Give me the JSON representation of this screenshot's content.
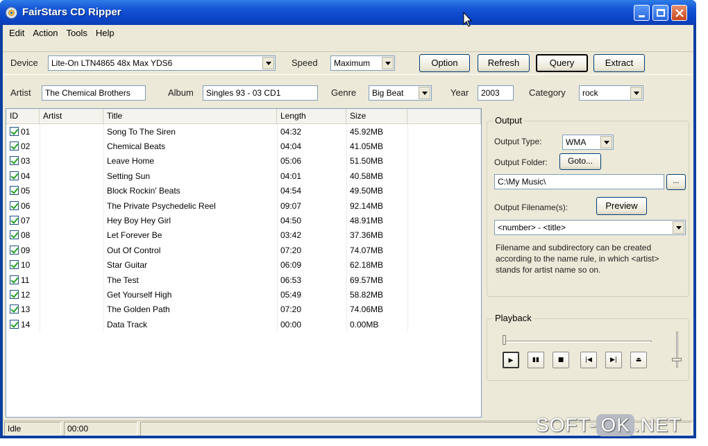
{
  "window": {
    "title": "FairStars CD Ripper",
    "icon": "cd-disc-icon"
  },
  "menu": [
    "Edit",
    "Action",
    "Tools",
    "Help"
  ],
  "toolbar": {
    "device_label": "Device",
    "device_value": "Lite-On LTN4865 48x Max YDS6",
    "speed_label": "Speed",
    "speed_value": "Maximum",
    "option_label": "Option",
    "refresh_label": "Refresh",
    "query_label": "Query",
    "extract_label": "Extract"
  },
  "meta": {
    "artist_label": "Artist",
    "artist_value": "The Chemical Brothers",
    "album_label": "Album",
    "album_value": "Singles 93 - 03 CD1",
    "genre_label": "Genre",
    "genre_value": "Big Beat",
    "year_label": "Year",
    "year_value": "2003",
    "category_label": "Category",
    "category_value": "rock"
  },
  "tracklist": {
    "columns": [
      "ID",
      "Artist",
      "Title",
      "Length",
      "Size"
    ],
    "rows": [
      {
        "id": "01",
        "artist": "",
        "title": "Song To The Siren",
        "length": "04:32",
        "size": "45.92MB"
      },
      {
        "id": "02",
        "artist": "",
        "title": "Chemical Beats",
        "length": "04:04",
        "size": "41.05MB"
      },
      {
        "id": "03",
        "artist": "",
        "title": "Leave Home",
        "length": "05:06",
        "size": "51.50MB"
      },
      {
        "id": "04",
        "artist": "",
        "title": "Setting Sun",
        "length": "04:01",
        "size": "40.58MB"
      },
      {
        "id": "05",
        "artist": "",
        "title": "Block Rockin' Beats",
        "length": "04:54",
        "size": "49.50MB"
      },
      {
        "id": "06",
        "artist": "",
        "title": "The Private Psychedelic Reel",
        "length": "09:07",
        "size": "92.14MB"
      },
      {
        "id": "07",
        "artist": "",
        "title": "Hey Boy Hey Girl",
        "length": "04:50",
        "size": "48.91MB"
      },
      {
        "id": "08",
        "artist": "",
        "title": "Let Forever Be",
        "length": "03:42",
        "size": "37.36MB"
      },
      {
        "id": "09",
        "artist": "",
        "title": "Out Of Control",
        "length": "07:20",
        "size": "74.07MB"
      },
      {
        "id": "10",
        "artist": "",
        "title": "Star Guitar",
        "length": "06:09",
        "size": "62.18MB"
      },
      {
        "id": "11",
        "artist": "",
        "title": "The Test",
        "length": "06:53",
        "size": "69.57MB"
      },
      {
        "id": "12",
        "artist": "",
        "title": "Get Yourself High",
        "length": "05:49",
        "size": "58.82MB"
      },
      {
        "id": "13",
        "artist": "",
        "title": "The Golden Path",
        "length": "07:20",
        "size": "74.06MB"
      },
      {
        "id": "14",
        "artist": "",
        "title": "Data Track",
        "length": "00:00",
        "size": "0.00MB"
      }
    ]
  },
  "output": {
    "group_title": "Output",
    "type_label": "Output Type:",
    "type_value": "WMA",
    "folder_label": "Output Folder:",
    "goto_label": "Goto...",
    "folder_value": "C:\\My Music\\",
    "browse_label": "...",
    "filename_label": "Output Filename(s):",
    "preview_label": "Preview",
    "filename_value": "<number> - <title>",
    "description": "Filename and subdirectory can be created according to the name rule, in which <artist> stands for artist name so on."
  },
  "playback": {
    "group_title": "Playback",
    "buttons": [
      {
        "name": "play",
        "glyph": "▶"
      },
      {
        "name": "pause",
        "glyph": "▮▮"
      },
      {
        "name": "stop",
        "glyph": "■"
      },
      {
        "name": "previous",
        "glyph": "|◀"
      },
      {
        "name": "next",
        "glyph": "▶|"
      },
      {
        "name": "eject",
        "glyph": "⏏"
      }
    ]
  },
  "status": {
    "state": "Idle",
    "time": "00:00"
  },
  "watermark": {
    "left": "SOFT-",
    "ok": "OK",
    "right": ".NET"
  }
}
